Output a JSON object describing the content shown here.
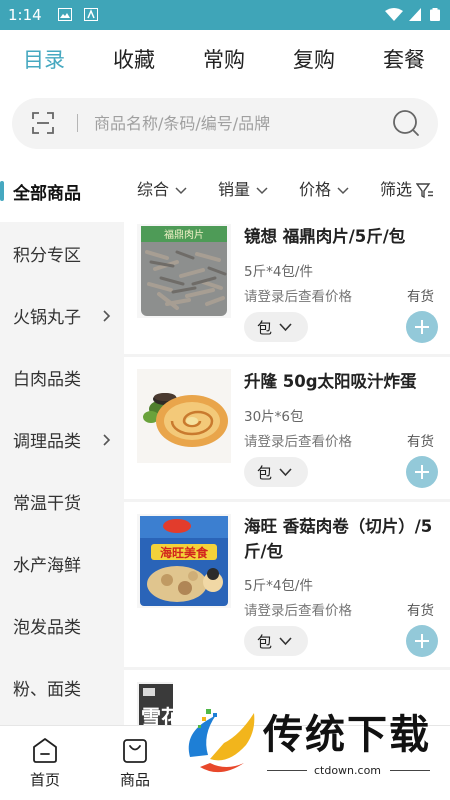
{
  "status_bar": {
    "time": "1:14"
  },
  "top_tabs": [
    {
      "label": "目录",
      "active": true
    },
    {
      "label": "收藏",
      "active": false
    },
    {
      "label": "常购",
      "active": false
    },
    {
      "label": "复购",
      "active": false
    },
    {
      "label": "套餐",
      "active": false
    }
  ],
  "search": {
    "placeholder": "商品名称/条码/编号/品牌"
  },
  "sidebar": {
    "items": [
      {
        "label": "全部商品",
        "active": true,
        "has_arrow": false
      },
      {
        "label": "积分专区",
        "active": false,
        "has_arrow": false
      },
      {
        "label": "火锅丸子",
        "active": false,
        "has_arrow": true
      },
      {
        "label": "白肉品类",
        "active": false,
        "has_arrow": false
      },
      {
        "label": "调理品类",
        "active": false,
        "has_arrow": true
      },
      {
        "label": "常温干货",
        "active": false,
        "has_arrow": false
      },
      {
        "label": "水产海鲜",
        "active": false,
        "has_arrow": false
      },
      {
        "label": "泡发品类",
        "active": false,
        "has_arrow": false
      },
      {
        "label": "粉、面类",
        "active": false,
        "has_arrow": false
      }
    ]
  },
  "filters": {
    "sort_overall": "综合",
    "sales": "销量",
    "price": "价格",
    "filter": "筛选"
  },
  "products": [
    {
      "name": "镜想 福鼎肉片/5斤/包",
      "spec": "5斤*4包/件",
      "login_note": "请登录后查看价格",
      "stock": "有货",
      "unit": "包",
      "package_text": "福鼎肉片"
    },
    {
      "name": "升隆 50g太阳吸汁炸蛋",
      "spec": "30片*6包",
      "login_note": "请登录后查看价格",
      "stock": "有货",
      "unit": "包"
    },
    {
      "name": "海旺 香菇肉卷（切片）/5斤/包",
      "spec": "5斤*4包/件",
      "login_note": "请登录后查看价格",
      "stock": "有货",
      "unit": "包",
      "package_text": "海旺美食"
    },
    {
      "package_text": "雪花"
    }
  ],
  "bottom_nav": [
    {
      "label": "首页",
      "icon": "home-icon"
    },
    {
      "label": "商品",
      "icon": "bag-icon"
    }
  ],
  "watermark": {
    "text": "传统下载",
    "url": "ctdown.com"
  },
  "colors": {
    "status_bar": "#3fa5b8",
    "accent": "#46a8c0",
    "add_button": "#93c9d9"
  }
}
